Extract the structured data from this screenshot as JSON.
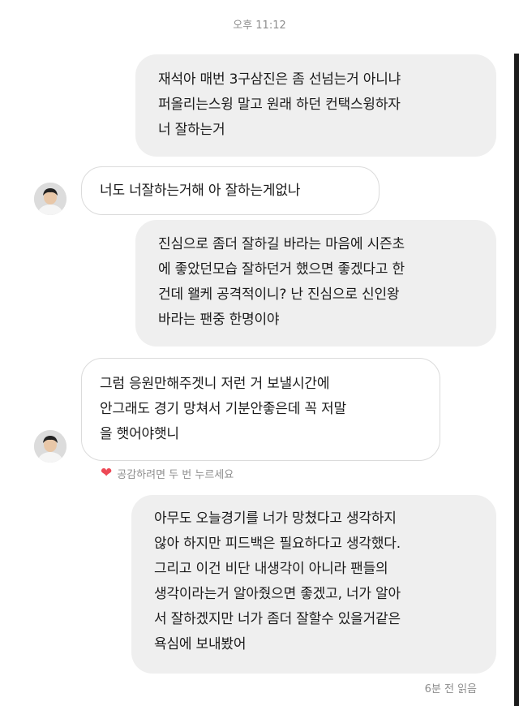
{
  "chat": {
    "timestamp": "오후 11:12",
    "messages": [
      {
        "side": "sent",
        "lines": [
          "재석아 매번 3구삼진은 좀 선넘는거 아니냐",
          "퍼올리는스윙 말고 원래 하던 컨택스윙하자",
          "너 잘하는거"
        ]
      },
      {
        "side": "received",
        "lines": [
          "너도 너잘하는거해 아 잘하는게없나"
        ]
      },
      {
        "side": "sent",
        "lines": [
          "진심으로 좀더 잘하길 바라는 마음에 시즌초",
          "에 좋았던모습 잘하던거 했으면 좋겠다고 한",
          "건데 왤케 공격적이니? 난 진심으로 신인왕",
          "바라는 팬중 한명이야"
        ]
      },
      {
        "side": "received",
        "lines": [
          "그럼 응원만해주겟니 저런 거 보낼시간에",
          "안그래도 경기 망쳐서 기분안좋은데 꼭 저말",
          "을 햇어야햇니"
        ]
      },
      {
        "side": "sent",
        "lines": [
          "아무도 오늘경기를 너가 망쳤다고 생각하지",
          "않아 하지만 피드백은 필요하다고 생각했다.",
          "그리고 이건 비단 내생각이 아니라 팬들의",
          "생각이라는거 알아줬으면 좋겠고, 너가 알아",
          "서 잘하겠지만 너가 좀더 잘할수 있을거같은",
          "욕심에 보내봤어"
        ]
      }
    ],
    "reaction_hint": "공감하려면 두 번 누르세요",
    "read_receipt": "6분 전 읽음"
  },
  "colors": {
    "sent_bubble": "#efefef",
    "received_border": "#dbdbdb",
    "meta_text": "#8e8e8e",
    "heart": "#ed4956"
  }
}
